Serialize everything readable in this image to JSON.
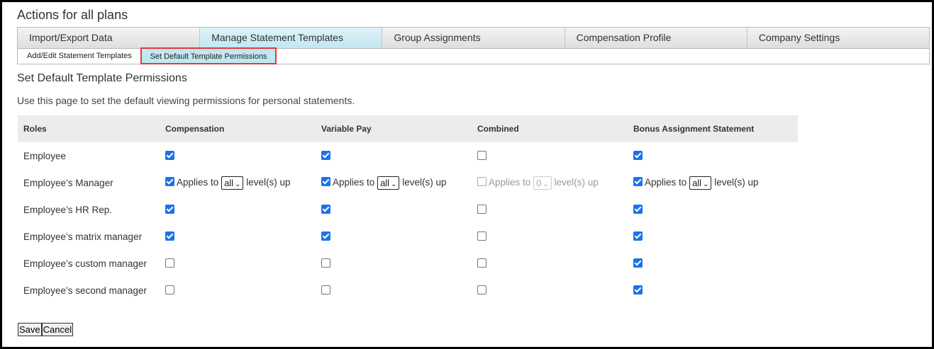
{
  "page": {
    "title": "Actions for all plans"
  },
  "tabs": [
    {
      "label": "Import/Export Data",
      "active": false
    },
    {
      "label": "Manage Statement Templates",
      "active": true
    },
    {
      "label": "Group Assignments",
      "active": false
    },
    {
      "label": "Compensation Profile",
      "active": false
    },
    {
      "label": "Company Settings",
      "active": false
    }
  ],
  "subtabs": [
    {
      "label": "Add/Edit Statement Templates",
      "active": false
    },
    {
      "label": "Set Default Template Permissions",
      "active": true
    }
  ],
  "section": {
    "title": "Set Default Template Permissions",
    "description": "Use this page to set the default viewing permissions for personal statements."
  },
  "table": {
    "headers": [
      "Roles",
      "Compensation",
      "Variable Pay",
      "Combined",
      "Bonus Assignment Statement"
    ],
    "applies_to_label": "Applies to",
    "levels_up_label": "level(s) up",
    "rows": [
      {
        "role": "Employee",
        "values": [
          true,
          true,
          false,
          true
        ]
      },
      {
        "role": "Employee’s Manager",
        "values": [
          true,
          true,
          false,
          true
        ],
        "levels": [
          "all",
          "all",
          "0",
          "all"
        ]
      },
      {
        "role": "Employee’s HR Rep.",
        "values": [
          true,
          true,
          false,
          true
        ]
      },
      {
        "role": "Employee’s matrix manager",
        "values": [
          true,
          true,
          false,
          true
        ]
      },
      {
        "role": "Employee’s custom manager",
        "values": [
          false,
          false,
          false,
          true
        ]
      },
      {
        "role": "Employee’s second manager",
        "values": [
          false,
          false,
          false,
          true
        ]
      }
    ]
  },
  "buttons": {
    "save_label": "Save",
    "cancel_label": "Cancel"
  },
  "colors": {
    "accent_tab": "#c2e7f1",
    "highlight_border": "#e23b3b",
    "checkbox_on": "#1a73e8"
  }
}
